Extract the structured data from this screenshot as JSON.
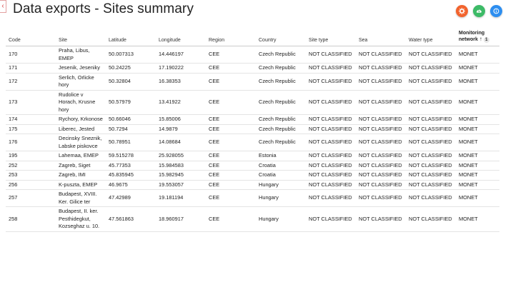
{
  "header": {
    "title": "Data exports - Sites summary",
    "back_glyph": "‹",
    "colors": {
      "settings": "#f2642e",
      "export": "#3dbb67",
      "info": "#2d8ef0"
    }
  },
  "columns": [
    "Code",
    "Site",
    "Latitude",
    "Longitude",
    "Region",
    "Country",
    "Site type",
    "Sea",
    "Water type"
  ],
  "monitoring": {
    "label": "Monitoring network",
    "sort_arrow": "↑",
    "sort_index": "1"
  },
  "rows": [
    {
      "code": "170",
      "site": "Praha, Libus, EMEP",
      "lat": "50.007313",
      "lon": "14.446197",
      "region": "CEE",
      "country": "Czech Republic",
      "site_type": "NOT CLASSIFIED",
      "sea": "NOT CLASSIFIED",
      "water_type": "NOT CLASSIFIED",
      "network": "MONET"
    },
    {
      "code": "171",
      "site": "Jesenik, Jeseniky",
      "lat": "50.24225",
      "lon": "17.190222",
      "region": "CEE",
      "country": "Czech Republic",
      "site_type": "NOT CLASSIFIED",
      "sea": "NOT CLASSIFIED",
      "water_type": "NOT CLASSIFIED",
      "network": "MONET"
    },
    {
      "code": "172",
      "site": "Serlich, Orlicke hory",
      "lat": "50.32804",
      "lon": "16.38353",
      "region": "CEE",
      "country": "Czech Republic",
      "site_type": "NOT CLASSIFIED",
      "sea": "NOT CLASSIFIED",
      "water_type": "NOT CLASSIFIED",
      "network": "MONET"
    },
    {
      "code": "173",
      "site": "Rudolice v Horach, Krusne hory",
      "lat": "50.57979",
      "lon": "13.41922",
      "region": "CEE",
      "country": "Czech Republic",
      "site_type": "NOT CLASSIFIED",
      "sea": "NOT CLASSIFIED",
      "water_type": "NOT CLASSIFIED",
      "network": "MONET"
    },
    {
      "code": "174",
      "site": "Rychory, Krkonose",
      "lat": "50.66046",
      "lon": "15.85006",
      "region": "CEE",
      "country": "Czech Republic",
      "site_type": "NOT CLASSIFIED",
      "sea": "NOT CLASSIFIED",
      "water_type": "NOT CLASSIFIED",
      "network": "MONET"
    },
    {
      "code": "175",
      "site": "Liberec, Jested",
      "lat": "50.7294",
      "lon": "14.9879",
      "region": "CEE",
      "country": "Czech Republic",
      "site_type": "NOT CLASSIFIED",
      "sea": "NOT CLASSIFIED",
      "water_type": "NOT CLASSIFIED",
      "network": "MONET"
    },
    {
      "code": "176",
      "site": "Decinsky Sneznik, Labske piskovce",
      "lat": "50.78951",
      "lon": "14.08684",
      "region": "CEE",
      "country": "Czech Republic",
      "site_type": "NOT CLASSIFIED",
      "sea": "NOT CLASSIFIED",
      "water_type": "NOT CLASSIFIED",
      "network": "MONET"
    },
    {
      "code": "195",
      "site": "Lahemaa, EMEP",
      "lat": "59.515278",
      "lon": "25.928055",
      "region": "CEE",
      "country": "Estonia",
      "site_type": "NOT CLASSIFIED",
      "sea": "NOT CLASSIFIED",
      "water_type": "NOT CLASSIFIED",
      "network": "MONET"
    },
    {
      "code": "252",
      "site": "Zagreb, Siget",
      "lat": "45.77353",
      "lon": "15.984583",
      "region": "CEE",
      "country": "Croatia",
      "site_type": "NOT CLASSIFIED",
      "sea": "NOT CLASSIFIED",
      "water_type": "NOT CLASSIFIED",
      "network": "MONET"
    },
    {
      "code": "253",
      "site": "Zagreb, IMI",
      "lat": "45.835945",
      "lon": "15.982945",
      "region": "CEE",
      "country": "Croatia",
      "site_type": "NOT CLASSIFIED",
      "sea": "NOT CLASSIFIED",
      "water_type": "NOT CLASSIFIED",
      "network": "MONET"
    },
    {
      "code": "256",
      "site": "K-puszta, EMEP",
      "lat": "46.9675",
      "lon": "19.553057",
      "region": "CEE",
      "country": "Hungary",
      "site_type": "NOT CLASSIFIED",
      "sea": "NOT CLASSIFIED",
      "water_type": "NOT CLASSIFIED",
      "network": "MONET"
    },
    {
      "code": "257",
      "site": "Budapest, XVIII. Ker. Gilice ter",
      "lat": "47.42989",
      "lon": "19.181194",
      "region": "CEE",
      "country": "Hungary",
      "site_type": "NOT CLASSIFIED",
      "sea": "NOT CLASSIFIED",
      "water_type": "NOT CLASSIFIED",
      "network": "MONET"
    },
    {
      "code": "258",
      "site": "Budapest, II. ker. Pesthidegkut, Kozseghaz u. 10.",
      "lat": "47.561863",
      "lon": "18.960917",
      "region": "CEE",
      "country": "Hungary",
      "site_type": "NOT CLASSIFIED",
      "sea": "NOT CLASSIFIED",
      "water_type": "NOT CLASSIFIED",
      "network": "MONET"
    }
  ]
}
